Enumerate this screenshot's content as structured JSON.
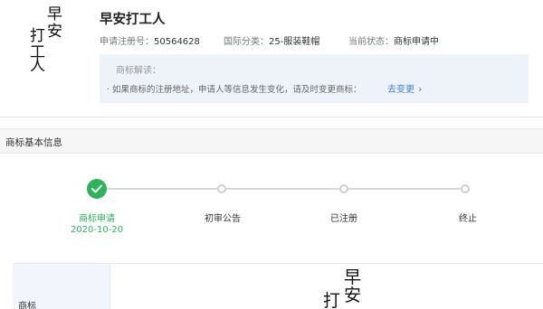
{
  "trademark": {
    "image_chars": [
      "早",
      "安",
      "打",
      "工",
      "人"
    ],
    "name": "早安打工人",
    "reg_label": "申请注册号：",
    "reg_number": "50564628",
    "class_label": "国际分类：",
    "class_value": "25-服装鞋帽",
    "status_label": "当前状态：",
    "status_value": "商标申请中"
  },
  "notice": {
    "title": "商标解读：",
    "text": "· 如果商标的注册地址，申请人等信息发生变化，请及时变更商标：",
    "link": "去变更",
    "link_icon": "chevron-right-icon"
  },
  "section": {
    "title": "商标基本信息"
  },
  "steps": [
    {
      "label": "商标申请",
      "date": "2020-10-20",
      "done": true
    },
    {
      "label": "初审公告",
      "date": "",
      "done": false
    },
    {
      "label": "已注册",
      "date": "",
      "done": false
    },
    {
      "label": "终止",
      "date": "",
      "done": false
    }
  ],
  "info": {
    "label": "商标"
  },
  "colors": {
    "accent_blue": "#3a7ee8",
    "success_green": "#2fb35a",
    "notice_bg": "#eef3fa"
  }
}
